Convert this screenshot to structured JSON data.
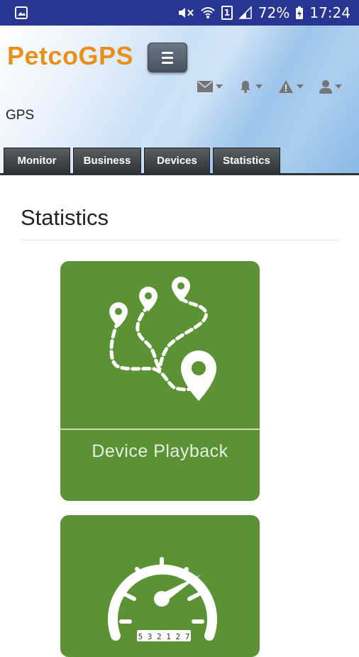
{
  "status_bar": {
    "battery": "72%",
    "time": "17:24",
    "sim": "1"
  },
  "header": {
    "brand": "PetcoGPS",
    "subtitle": "GPS",
    "icons": [
      "envelope-icon",
      "bell-icon",
      "warning-icon",
      "user-icon"
    ]
  },
  "tabs": [
    "Monitor",
    "Business",
    "Devices",
    "Statistics"
  ],
  "page": {
    "title": "Statistics"
  },
  "tiles": [
    {
      "label": "Device Playback",
      "icon": "route-playback-icon"
    },
    {
      "label": "",
      "icon": "speedometer-icon",
      "odometer": "5 3 2 1 2 7"
    }
  ],
  "colors": {
    "status_bar": "#283593",
    "brand": "#e8901a",
    "tile_green": "#5a9234"
  }
}
